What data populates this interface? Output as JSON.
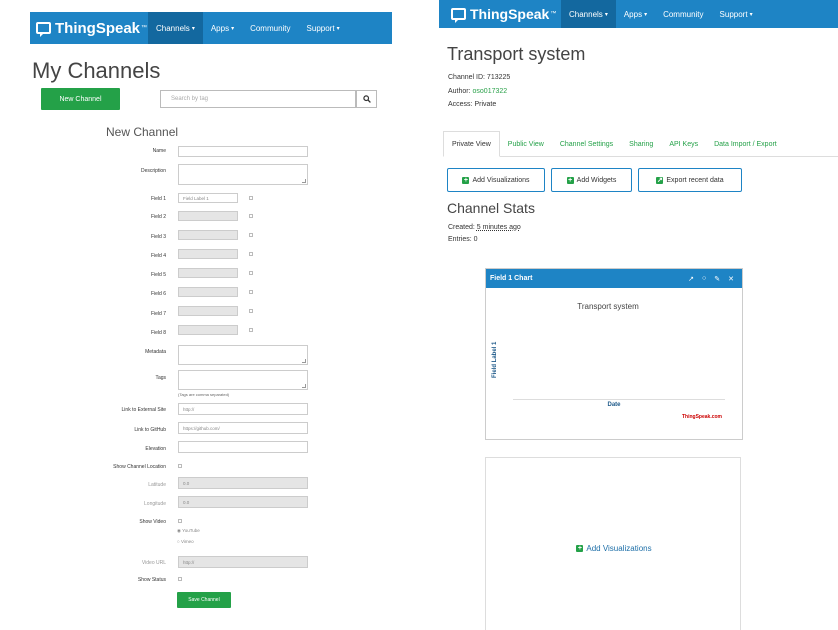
{
  "brand": {
    "name": "ThingSpeak",
    "tm": "™"
  },
  "nav": {
    "items": [
      {
        "label": "Channels"
      },
      {
        "label": "Apps"
      },
      {
        "label": "Community"
      },
      {
        "label": "Support"
      }
    ],
    "caret": "▾"
  },
  "left": {
    "page_title": "My Channels",
    "new_channel_label": "New Channel",
    "search_placeholder": "Search by tag",
    "form_title": "New Channel",
    "labels": {
      "name": "Name",
      "description": "Description",
      "field1": "Field 1",
      "field2": "Field 2",
      "field3": "Field 3",
      "field4": "Field 4",
      "field5": "Field 5",
      "field6": "Field 6",
      "field7": "Field 7",
      "field8": "Field 8",
      "metadata": "Metadata",
      "tags": "Tags",
      "external_site": "Link to External Site",
      "github": "Link to GitHub",
      "elevation": "Elevation",
      "show_location": "Show Channel Location",
      "latitude": "Latitude",
      "longitude": "Longitude",
      "show_video": "Show Video",
      "video_url": "Video URL",
      "show_status": "Show Status"
    },
    "values": {
      "field1": "Field Label 1",
      "tags_hint": "(Tags are comma separated)",
      "external_site": "http://",
      "github": "https://github.com/",
      "latitude": "0.0",
      "longitude": "0.0",
      "video_url": "http://",
      "youtube": "YouTube",
      "vimeo": "Vimeo"
    },
    "save_label": "Save Channel"
  },
  "right": {
    "page_title": "Transport system",
    "channel_id_label": "Channel ID: ",
    "channel_id": "713225",
    "author_label": "Author: ",
    "author": "oso017322",
    "access": "Access: Private",
    "tabs": [
      {
        "label": "Private View",
        "active": true
      },
      {
        "label": "Public View"
      },
      {
        "label": "Channel Settings"
      },
      {
        "label": "Sharing"
      },
      {
        "label": "API Keys"
      },
      {
        "label": "Data Import / Export"
      }
    ],
    "buttons": {
      "add_viz": "Add Visualizations",
      "add_widgets": "Add Widgets",
      "export": "Export recent data"
    },
    "stats_title": "Channel Stats",
    "created_label": "Created: ",
    "created": "5 minutes ago",
    "entries": "Entries: 0",
    "chart": {
      "header": "Field 1 Chart",
      "title": "Transport system",
      "ylabel": "Field Label 1",
      "xlabel": "Date",
      "credit": "ThingSpeak.com"
    },
    "viz_link": "Add Visualizations"
  },
  "colors": {
    "nav": "#1e84c5",
    "nav_active": "#13689f",
    "green": "#24a148",
    "link": "#2aa14a"
  }
}
